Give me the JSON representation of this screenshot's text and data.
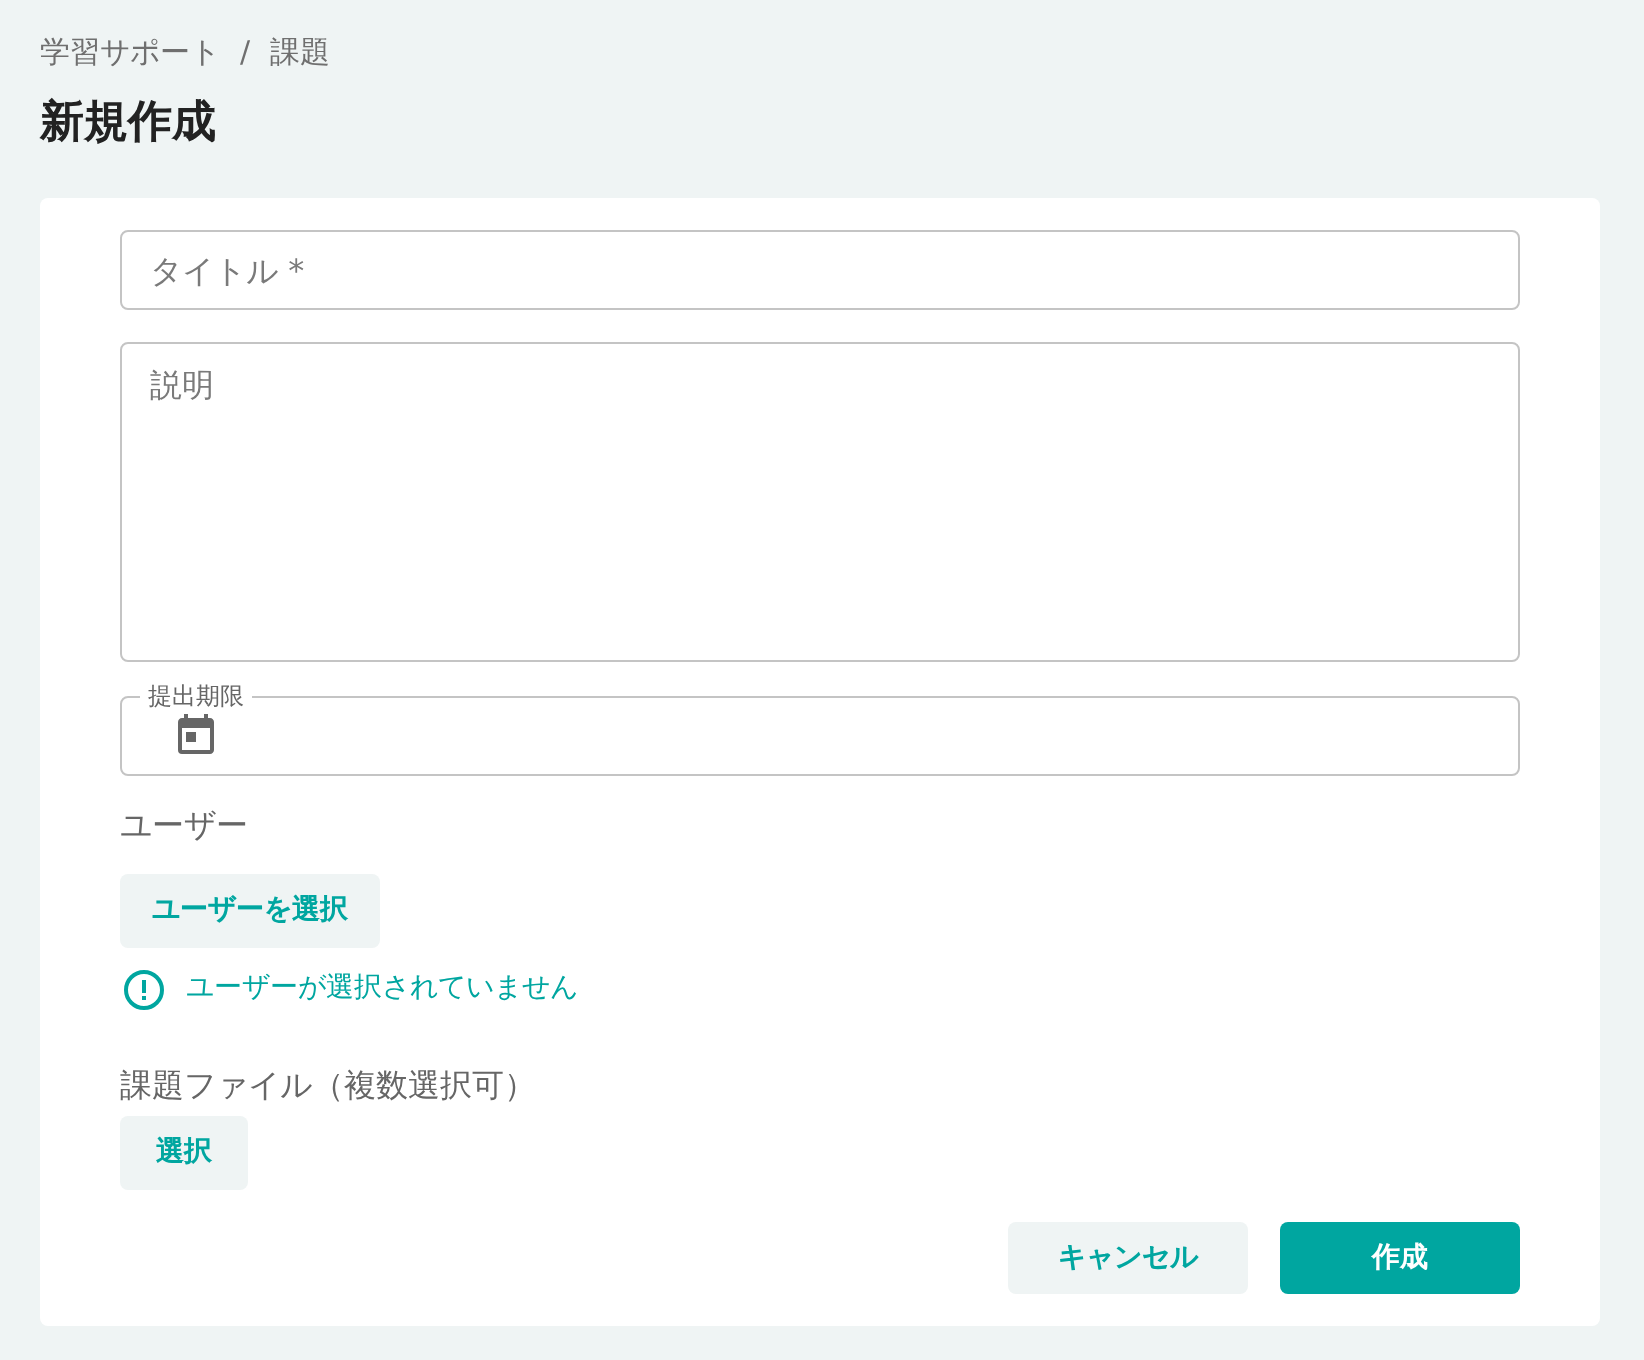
{
  "breadcrumb": {
    "items": [
      "学習サポート",
      "課題"
    ],
    "separator": "/"
  },
  "page_title": "新規作成",
  "fields": [
    {
      "kind": "text",
      "placeholder": "タイトル *"
    },
    {
      "kind": "textarea",
      "placeholder": "説明"
    },
    {
      "kind": "date",
      "label": "提出期限"
    }
  ],
  "users": {
    "label": "ユーザー",
    "button": "ユーザーを選択",
    "warning": "ユーザーが選択されていません"
  },
  "files": {
    "label": "課題ファイル（複数選択可）",
    "button": "選択"
  },
  "actions": [
    {
      "kind": "secondary",
      "label": "キャンセル"
    },
    {
      "kind": "primary",
      "label": "作成"
    }
  ]
}
